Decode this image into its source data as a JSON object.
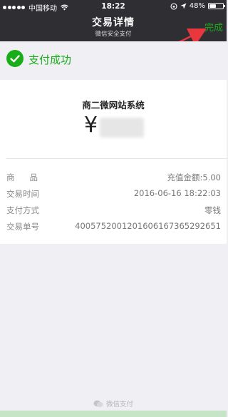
{
  "status_bar": {
    "carrier": "中国移动",
    "time": "18:22",
    "battery": "48%",
    "battery_level": 0.48
  },
  "nav": {
    "title": "交易详情",
    "subtitle": "微信安全支付",
    "done_label": "完成"
  },
  "success": {
    "text": "支付成功"
  },
  "receipt": {
    "merchant": "商二微网站系统",
    "currency_symbol": "¥",
    "rows": [
      {
        "label": "商品",
        "value": "充值金额:5.00"
      },
      {
        "label": "交易时间",
        "value": "2016-06-16 18:22:03"
      },
      {
        "label": "支付方式",
        "value": "零钱"
      },
      {
        "label": "交易单号",
        "value": "4005752001201606167365292651"
      }
    ]
  },
  "footer": {
    "text": "微信支付"
  },
  "colors": {
    "accent": "#1aad19",
    "nav_bg": "#2e2e33",
    "arrow": "#e8383d"
  }
}
